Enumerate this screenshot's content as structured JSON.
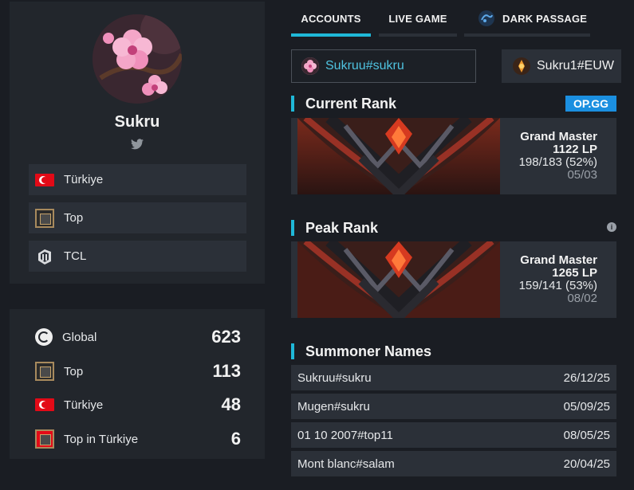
{
  "profile": {
    "name": "Sukru",
    "tags": [
      {
        "icon": "turkey-flag-icon",
        "label": "Türkiye"
      },
      {
        "icon": "top-lane-icon",
        "label": "Top"
      },
      {
        "icon": "tcl-league-icon",
        "label": "TCL"
      }
    ]
  },
  "leaderboard": [
    {
      "icon": "globe-icon",
      "label": "Global",
      "value": "623"
    },
    {
      "icon": "top-lane-icon",
      "label": "Top",
      "value": "113"
    },
    {
      "icon": "turkey-flag-icon",
      "label": "Türkiye",
      "value": "48"
    },
    {
      "icon": "turkey-top-icon",
      "label": "Top in Türkiye",
      "value": "6"
    }
  ],
  "tabs": [
    {
      "label": "ACCOUNTS",
      "active": true
    },
    {
      "label": "LIVE GAME",
      "active": false
    },
    {
      "label": "DARK PASSAGE",
      "active": false
    }
  ],
  "accounts": [
    {
      "label": "Sukruu#sukru",
      "selected": true
    },
    {
      "label": "Sukru1#EUW",
      "selected": false
    }
  ],
  "current_rank": {
    "title": "Current Rank",
    "source": "OP.GG",
    "tier": "Grand Master",
    "lp": "1122 LP",
    "record": "198/183 (52%)",
    "date": "05/03"
  },
  "peak_rank": {
    "title": "Peak Rank",
    "info": "i",
    "tier": "Grand Master",
    "lp": "1265 LP",
    "record": "159/141 (53%)",
    "date": "08/02"
  },
  "summoner_names": {
    "title": "Summoner Names",
    "rows": [
      {
        "name": "Sukruu#sukru",
        "date": "26/12/25"
      },
      {
        "name": "Mugen#sukru",
        "date": "05/09/25"
      },
      {
        "name": "01 10 2007#top11",
        "date": "08/05/25"
      },
      {
        "name": "Mont blanc#salam",
        "date": "20/04/25"
      }
    ]
  },
  "colors": {
    "accent": "#1fb8d8",
    "account_link": "#4fc3e0",
    "opgg_badge": "#1b8fe0"
  }
}
